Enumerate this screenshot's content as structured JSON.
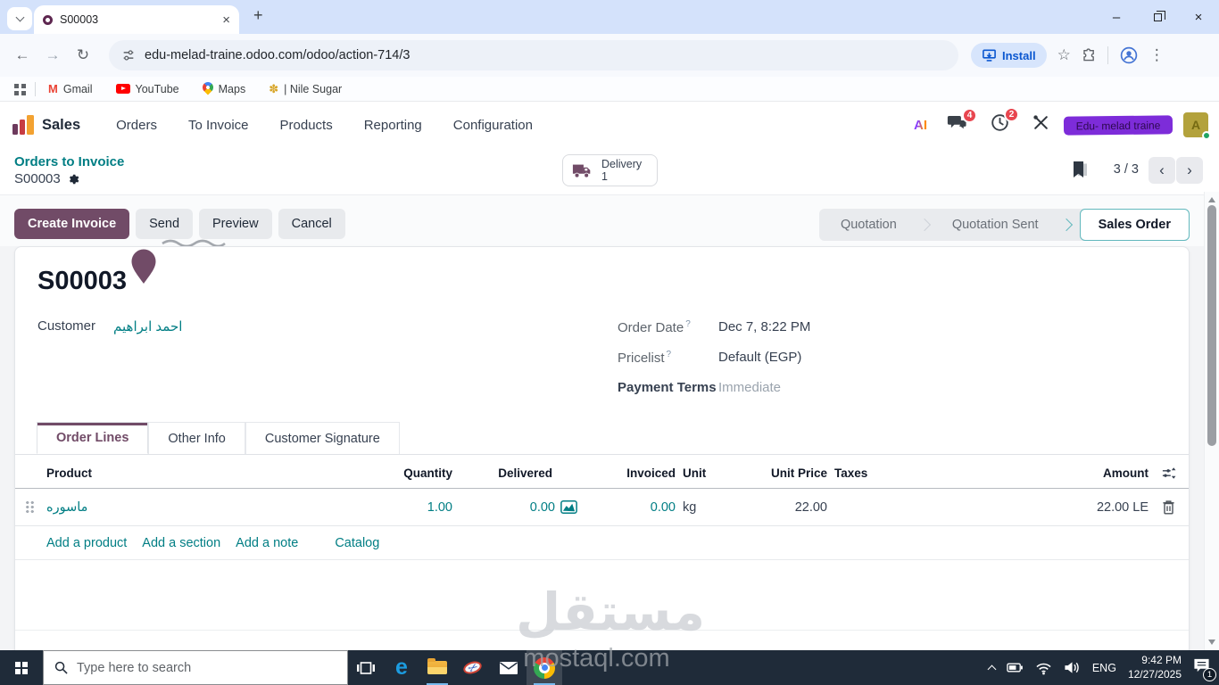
{
  "glyphs": {
    "close": "×",
    "minimize": "–",
    "new_tab": "+",
    "back": "←",
    "forward": "→",
    "reload": "↻",
    "star": "☆",
    "more": "⋮",
    "prev": "‹",
    "next": "›",
    "scissors": "✂",
    "help": "?"
  },
  "browser": {
    "tab_title": "S00003",
    "url": "edu-melad-traine.odoo.com/odoo/action-714/3",
    "install_label": "Install",
    "bookmarks": [
      {
        "icon": "M",
        "label": "Gmail"
      },
      {
        "label": "YouTube"
      },
      {
        "label": "Maps"
      },
      {
        "icon": "✽",
        "label": "| Nile Sugar"
      }
    ]
  },
  "nav": {
    "app": "Sales",
    "menus": [
      "Orders",
      "To Invoice",
      "Products",
      "Reporting",
      "Configuration"
    ],
    "ai_label": "AI",
    "chat_count": "4",
    "activity_count": "2",
    "user_label": "Edu- melad traine",
    "avatar": "A"
  },
  "page": {
    "breadcrumb_parent": "Orders to Invoice",
    "breadcrumb_current": "S00003",
    "delivery_label": "Delivery",
    "delivery_count": "1",
    "pager": "3 / 3"
  },
  "control": {
    "create": "Create Invoice",
    "secondary": [
      "Send",
      "Preview",
      "Cancel"
    ],
    "steps": [
      "Quotation",
      "Quotation Sent",
      "Sales Order"
    ],
    "active_step": "Sales Order"
  },
  "record": {
    "name": "S00003",
    "customer_label": "Customer",
    "customer_value": "احمد ابراهيم",
    "fields": [
      {
        "label": "Order Date",
        "value": "Dec 7, 8:22 PM"
      },
      {
        "label": "Pricelist",
        "value": "Default (EGP)"
      },
      {
        "label": "Payment Terms",
        "value": "Immediate"
      }
    ],
    "tabs": [
      "Order Lines",
      "Other Info",
      "Customer Signature"
    ],
    "active_tab": "Order Lines",
    "table": {
      "headers": [
        "Product",
        "Quantity",
        "Delivered",
        "Invoiced",
        "Unit",
        "Unit Price",
        "Taxes",
        "Amount"
      ],
      "row": {
        "product": "ماسوره",
        "quantity": "1.00",
        "delivered": "0.00",
        "invoiced": "0.00",
        "unit": "kg",
        "unit_price": "22.00",
        "taxes": "",
        "amount": "22.00 LE"
      },
      "footer_links": [
        "Add a product",
        "Add a section",
        "Add a note",
        "Catalog"
      ]
    }
  },
  "watermark": {
    "line1": "مستقل",
    "line2": "mostaql.com"
  },
  "taskbar": {
    "search_placeholder": "Type here to search",
    "edge_letter": "e",
    "language": "ENG",
    "time": "9:42 PM",
    "date": "12/27/2025",
    "notification_count": "1"
  },
  "colors": {
    "primary": "#714B67",
    "link": "#017E84",
    "badge": "#E8464F",
    "taskbar_bg": "#1F2B39"
  }
}
